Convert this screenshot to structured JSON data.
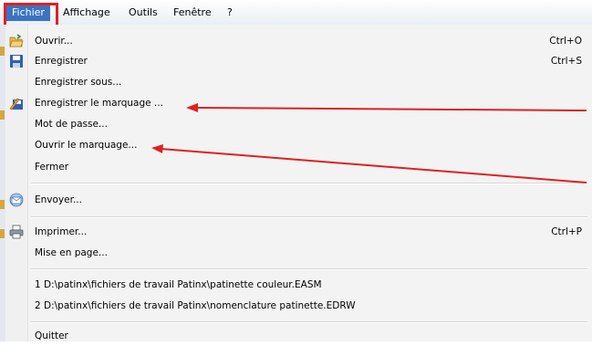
{
  "menubar": {
    "items": [
      "Fichier",
      "Affichage",
      "Outils",
      "Fenêtre",
      "?"
    ]
  },
  "menu": {
    "items": [
      {
        "label": "Ouvrir...",
        "shortcut": "Ctrl+O",
        "icon": "open-folder-icon"
      },
      {
        "label": "Enregistrer",
        "shortcut": "Ctrl+S",
        "icon": "save-disk-icon"
      },
      {
        "label": "Enregistrer sous...",
        "shortcut": "",
        "icon": ""
      },
      {
        "label": "Enregistrer le marquage ...",
        "shortcut": "",
        "icon": "save-markup-icon"
      },
      {
        "label": "Mot de passe...",
        "shortcut": "",
        "icon": ""
      },
      {
        "label": "Ouvrir le marquage...",
        "shortcut": "",
        "icon": ""
      },
      {
        "label": "Fermer",
        "shortcut": "",
        "icon": ""
      },
      {
        "label": "Envoyer...",
        "shortcut": "",
        "icon": "send-mail-icon"
      },
      {
        "label": "Imprimer...",
        "shortcut": "Ctrl+P",
        "icon": "printer-icon"
      },
      {
        "label": "Mise en page...",
        "shortcut": "",
        "icon": ""
      },
      {
        "label": "1 D:\\patinx\\fichiers de travail Patinx\\patinette couleur.EASM",
        "shortcut": "",
        "icon": ""
      },
      {
        "label": "2 D:\\patinx\\fichiers de travail Patinx\\nomenclature patinette.EDRW",
        "shortcut": "",
        "icon": ""
      },
      {
        "label": "Quitter",
        "shortcut": "",
        "icon": ""
      }
    ]
  },
  "colors": {
    "menu_active": "#3b73c2",
    "annotation_red": "#e02020",
    "menu_background": "#f3f3f3"
  }
}
